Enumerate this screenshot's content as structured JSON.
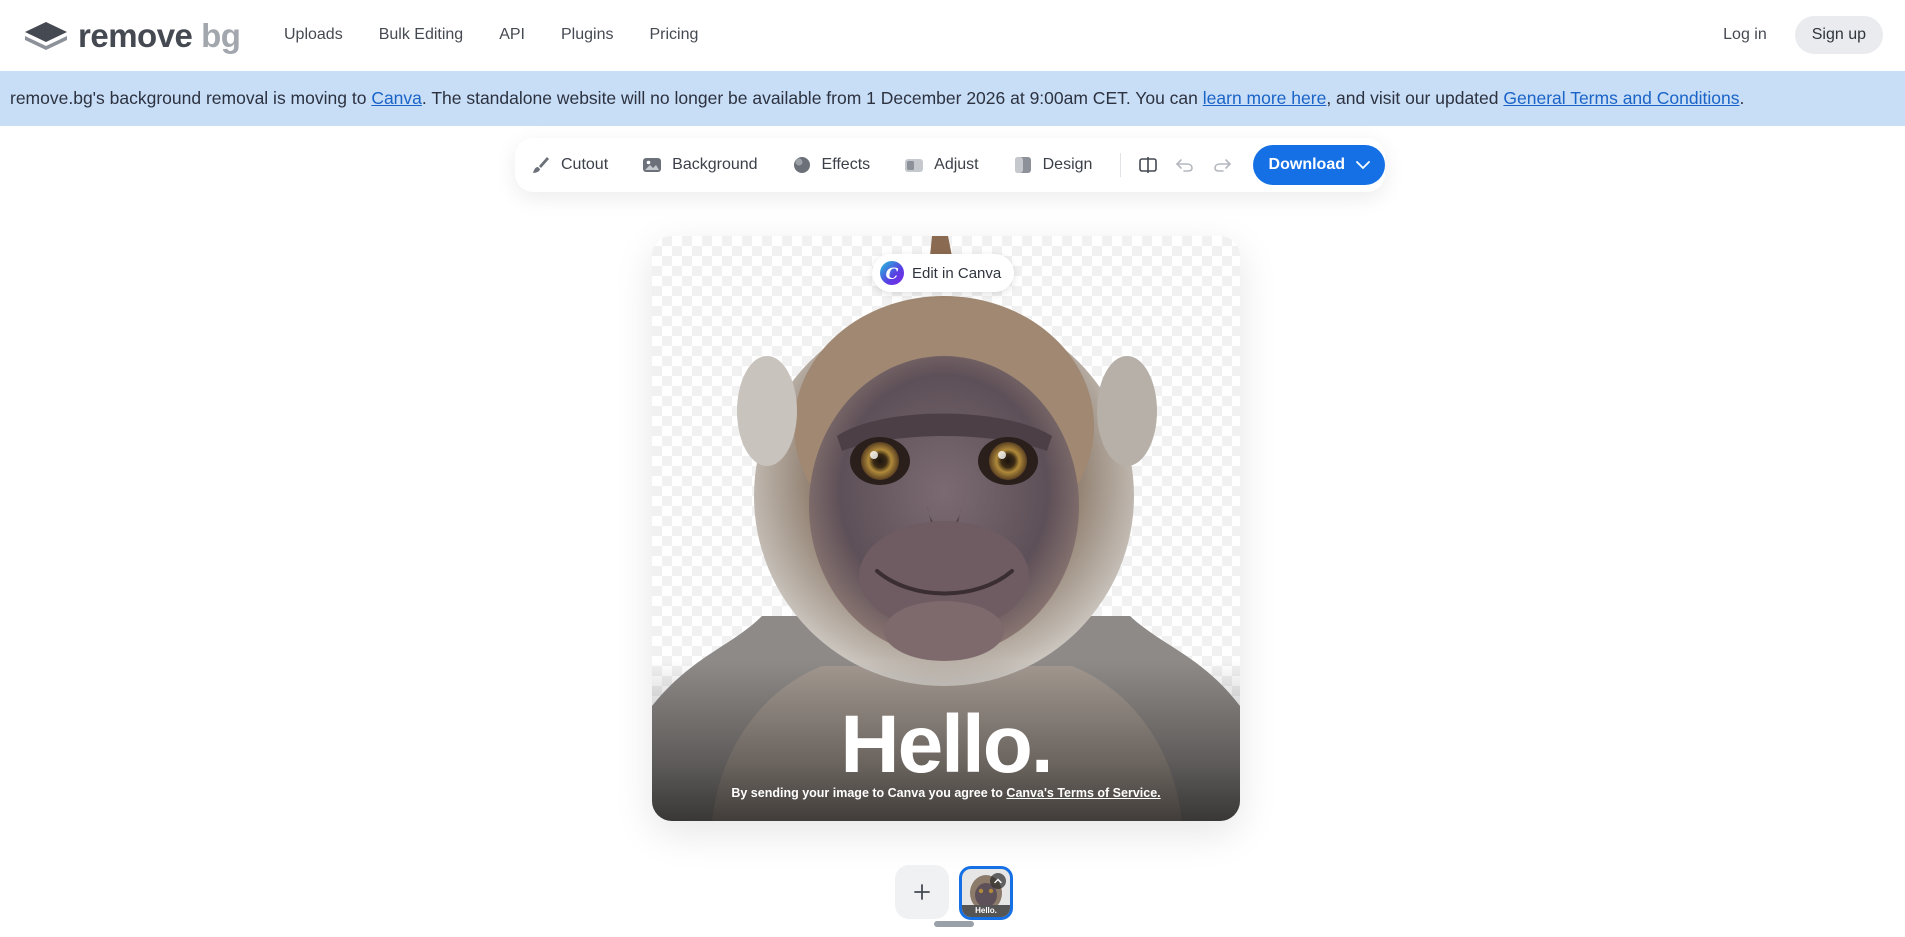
{
  "header": {
    "logo": {
      "word1": "remove",
      "word2": "bg"
    },
    "nav": [
      "Uploads",
      "Bulk Editing",
      "API",
      "Plugins",
      "Pricing"
    ],
    "login": "Log in",
    "signup": "Sign up"
  },
  "banner": {
    "t1": "remove.bg's background removal is moving to ",
    "link1": "Canva",
    "t2": ". The standalone website will no longer be available from 1 December 2026 at 9:00am CET. You can ",
    "link2": "learn more here",
    "t3": ", and visit our updated ",
    "link3": "General Terms and Conditions",
    "t4": "."
  },
  "toolbar": {
    "cutout": "Cutout",
    "background": "Background",
    "effects": "Effects",
    "adjust": "Adjust",
    "design": "Design",
    "download": "Download"
  },
  "canvas": {
    "edit_in_canva": "Edit in Canva",
    "hello": "Hello.",
    "tos_text": "By sending your image to Canva you agree to ",
    "tos_link": "Canva's Terms of Service."
  },
  "thumbs": {
    "thumb_text": "Hello."
  },
  "colors": {
    "accent": "#1570e6",
    "banner": "#c8ddf6"
  }
}
